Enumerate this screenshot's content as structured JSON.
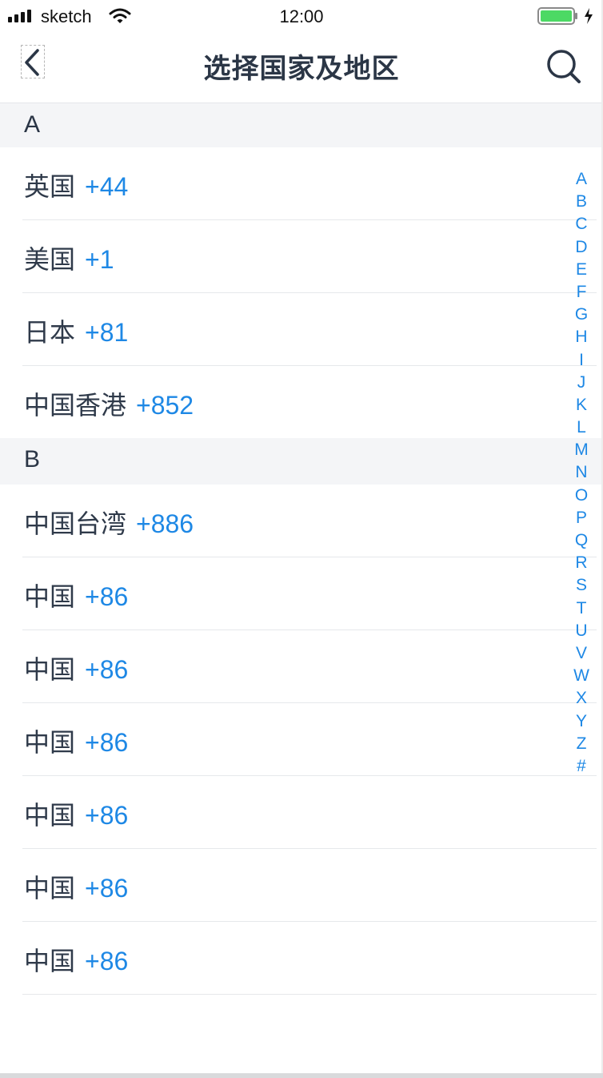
{
  "status_bar": {
    "carrier": "sketch",
    "time": "12:00",
    "battery_color": "#4cd964"
  },
  "nav": {
    "title": "选择国家及地区",
    "back_icon": "chevron-left-icon",
    "search_icon": "search-icon"
  },
  "sections": [
    {
      "letter": "A",
      "items": [
        {
          "country": "英国",
          "code": "+44"
        },
        {
          "country": "美国",
          "code": "+1"
        },
        {
          "country": "日本",
          "code": "+81"
        },
        {
          "country": "中国香港",
          "code": "+852"
        }
      ]
    },
    {
      "letter": "B",
      "items": [
        {
          "country": "中国台湾",
          "code": "+886"
        },
        {
          "country": "中国",
          "code": "+86"
        },
        {
          "country": "中国",
          "code": "+86"
        },
        {
          "country": "中国",
          "code": "+86"
        },
        {
          "country": "中国",
          "code": "+86"
        },
        {
          "country": "中国",
          "code": "+86"
        },
        {
          "country": "中国",
          "code": "+86"
        }
      ]
    }
  ],
  "index": [
    "A",
    "B",
    "C",
    "D",
    "E",
    "F",
    "G",
    "H",
    "I",
    "J",
    "K",
    "L",
    "M",
    "N",
    "O",
    "P",
    "Q",
    "R",
    "S",
    "T",
    "U",
    "V",
    "W",
    "X",
    "Y",
    "Z",
    "#"
  ],
  "colors": {
    "accent": "#1e88e5",
    "text": "#2f3a4a",
    "section_bg": "#f4f5f7"
  }
}
